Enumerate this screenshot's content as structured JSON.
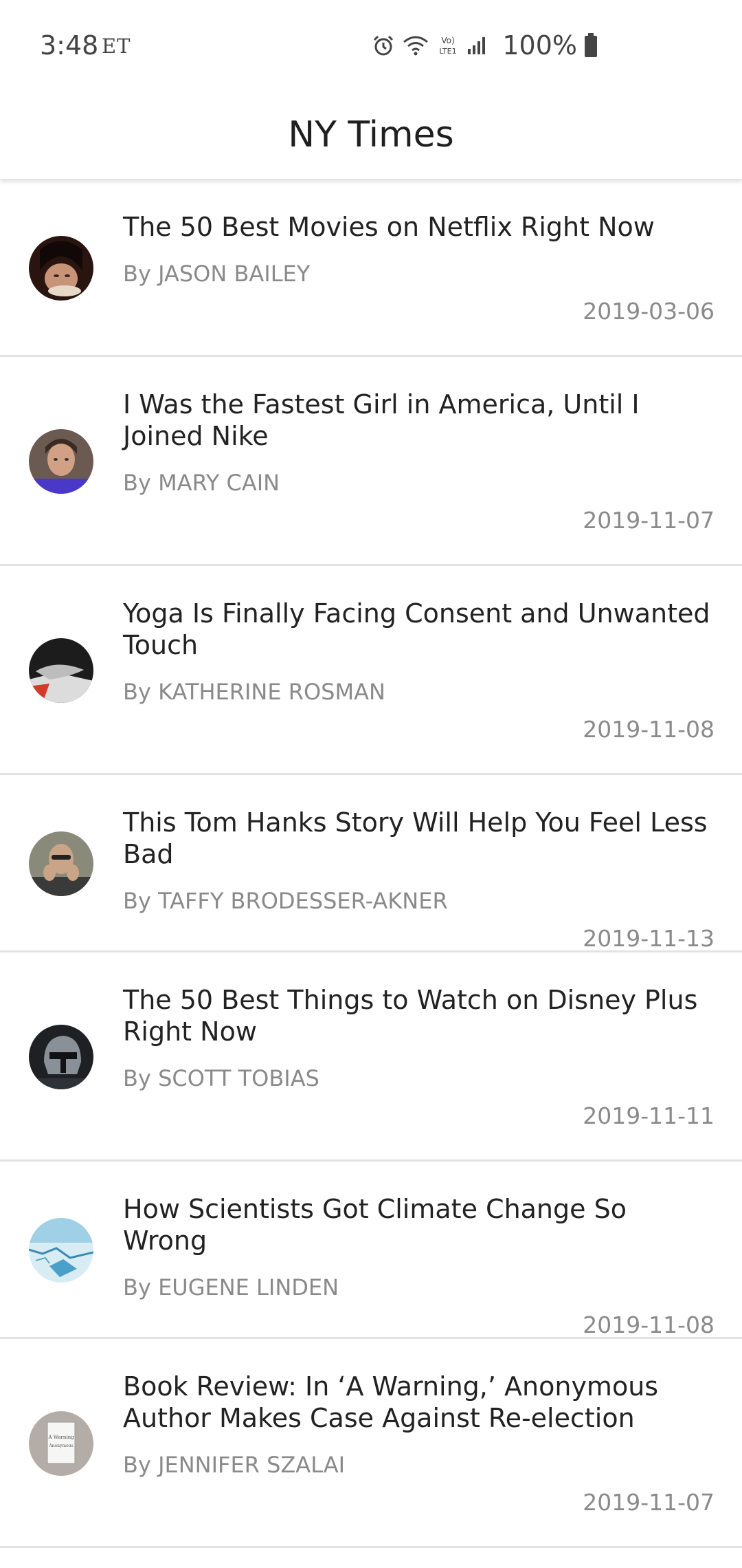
{
  "status_bar": {
    "time": "3:48",
    "carrier": "ET",
    "battery": "100%",
    "icons": [
      "alarm-icon",
      "wifi-icon",
      "volte-icon",
      "signal-icon",
      "battery-icon"
    ]
  },
  "app_bar": {
    "title": "NY Times"
  },
  "articles": [
    {
      "title": "The 50 Best Movies on Netflix Right Now",
      "author": "By JASON BAILEY",
      "date": "2019-03-06"
    },
    {
      "title": "I Was the Fastest Girl in America, Until I Joined Nike",
      "author": "By MARY CAIN",
      "date": "2019-11-07"
    },
    {
      "title": "Yoga Is Finally Facing Consent and Unwanted Touch",
      "author": "By KATHERINE ROSMAN",
      "date": "2019-11-08"
    },
    {
      "title": "This Tom Hanks Story Will Help You Feel Less Bad",
      "author": "By TAFFY BRODESSER-AKNER",
      "date": "2019-11-13"
    },
    {
      "title": "The 50 Best Things to Watch on Disney Plus Right Now",
      "author": "By SCOTT TOBIAS",
      "date": "2019-11-11"
    },
    {
      "title": "How Scientists Got Climate Change So Wrong",
      "author": "By EUGENE LINDEN",
      "date": "2019-11-08"
    },
    {
      "title": "Book Review: In ‘A Warning,’ Anonymous Author Makes Case Against Re-election",
      "author": "By JENNIFER SZALAI",
      "date": "2019-11-07",
      "thumbnail_text": "A Warning Anonymous"
    }
  ]
}
